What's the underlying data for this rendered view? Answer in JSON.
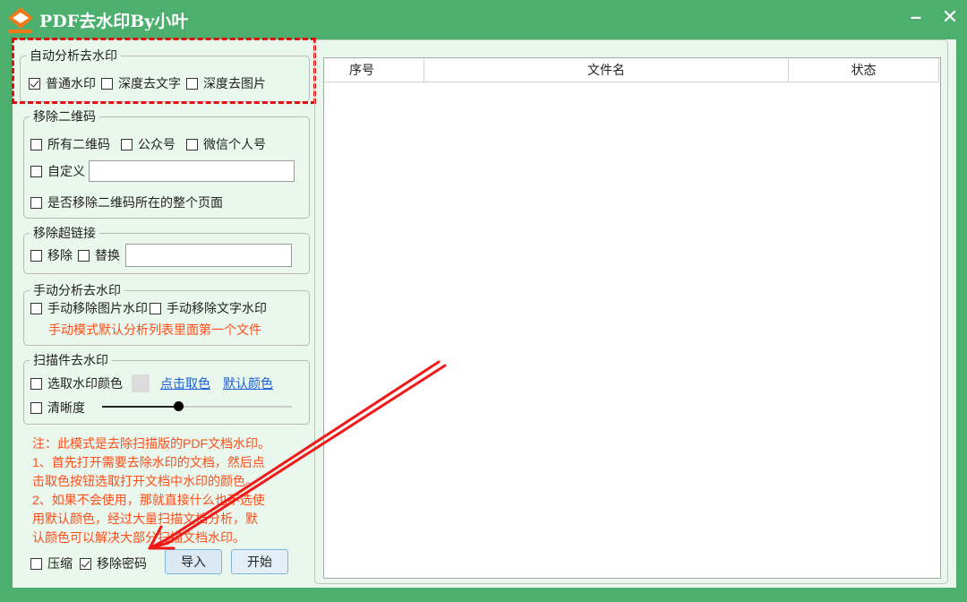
{
  "window": {
    "title": "PDF去水印By小叶",
    "minimize_glyph": "–",
    "close_glyph": "✕",
    "logo_icon": "logo-icon",
    "accent_color": "#4caf6e"
  },
  "auto_analysis": {
    "legend": "自动分析去水印",
    "options": [
      {
        "label": "普通水印",
        "checked": true
      },
      {
        "label": "深度去文字",
        "checked": false
      },
      {
        "label": "深度去图片",
        "checked": false
      }
    ]
  },
  "remove_qr": {
    "legend": "移除二维码",
    "options": [
      {
        "label": "所有二维码",
        "checked": false
      },
      {
        "label": "公众号",
        "checked": false
      },
      {
        "label": "微信个人号",
        "checked": false
      }
    ],
    "custom_label": "自定义",
    "custom_value": "",
    "whole_page_label": "是否移除二维码所在的整个页面"
  },
  "remove_links": {
    "legend": "移除超链接",
    "remove_label": "移除",
    "replace_label": "替换",
    "replace_value": ""
  },
  "manual_analysis": {
    "legend": "手动分析去水印",
    "image_label": "手动移除图片水印",
    "text_label": "手动移除文字水印",
    "hint": "手动模式默认分析列表里面第一个文件"
  },
  "scan_removal": {
    "legend": "扫描件去水印",
    "pick_color_label": "选取水印颜色",
    "click_pick": "点击取色",
    "default_color": "默认颜色",
    "swatch_color": "#dcdcdc",
    "clarity_label": "清晰度",
    "clarity_level": 0.4
  },
  "notes": [
    "注：此模式是去除扫描版的PDF文档水印。",
    "1、首先打开需要去除水印的文档，然后点",
    "击取色按钮选取打开文档中水印的颜色。",
    "2、如果不会使用，那就直接什么也不选使",
    "用默认颜色，经过大量扫描文档分析，默",
    "认颜色可以解决大部分扫描文档水印。"
  ],
  "bottom": {
    "compress_label": "压缩",
    "compress_checked": false,
    "remove_password_label": "移除密码",
    "remove_password_checked": true,
    "import_button": "导入",
    "start_button": "开始"
  },
  "file_list": {
    "columns": [
      "序号",
      "文件名",
      "状态"
    ],
    "rows": []
  }
}
